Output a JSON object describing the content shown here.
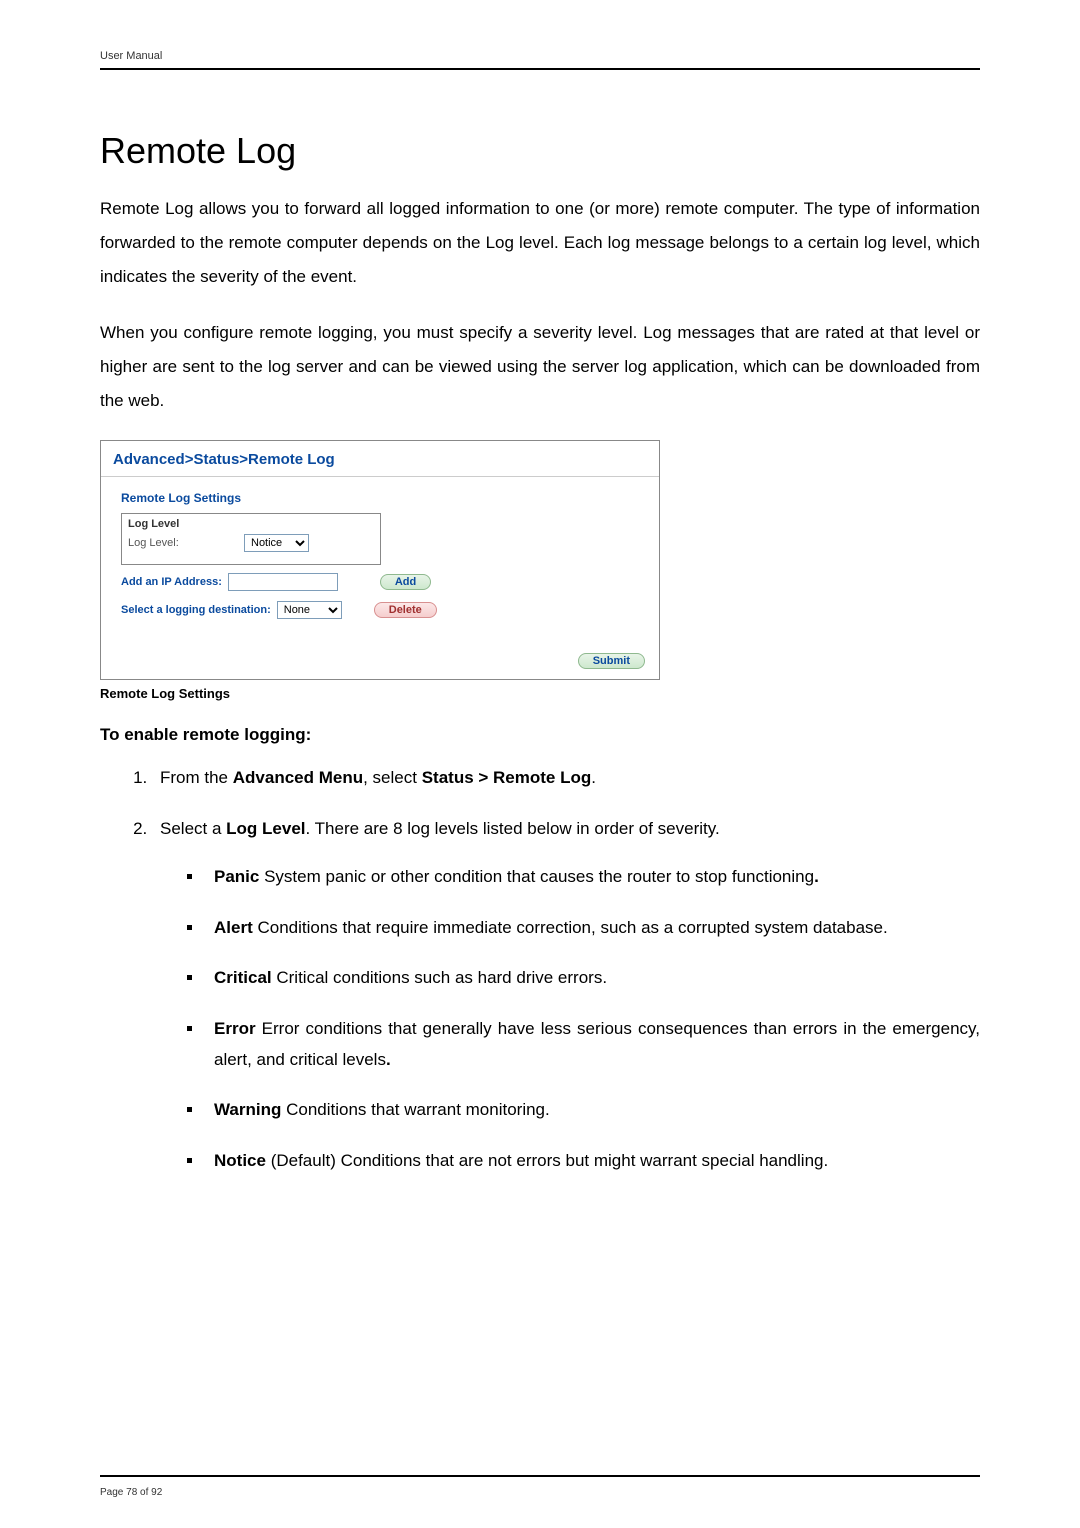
{
  "header": {
    "title": "User Manual"
  },
  "h1": "Remote Log",
  "para1": "Remote Log allows you to forward all logged information to one (or more) remote computer. The type of information forwarded to the remote computer depends on the Log level. Each log message belongs to a certain log level, which indicates the severity of the event.",
  "para2": "When you configure remote logging, you must specify a severity level. Log messages that are rated at that level or higher are sent to the log server and can be viewed using the server log application, which can be downloaded from the web.",
  "screenshot": {
    "breadcrumb": "Advanced>Status>Remote Log",
    "section_title": "Remote Log Settings",
    "loglevel_box_label": "Log Level",
    "loglevel_label": "Log Level:",
    "loglevel_value": "Notice",
    "add_ip_label": "Add an IP Address:",
    "add_btn": "Add",
    "dest_label": "Select a logging destination:",
    "dest_value": "None",
    "delete_btn": "Delete",
    "submit_btn": "Submit"
  },
  "caption": "Remote Log Settings",
  "h3": "To enable remote logging:",
  "step1_pre": "From the ",
  "step1_b1": "Advanced Menu",
  "step1_mid": ", select ",
  "step1_b2": "Status > Remote Log",
  "step1_post": ".",
  "step2_pre": "Select a ",
  "step2_b": "Log Level",
  "step2_post": ". There are 8 log levels listed below in order of severity.",
  "levels": {
    "panic_b": "Panic",
    "panic_t": " System panic or other condition that causes the router to stop functioning",
    "panic_dot": ".",
    "alert_b": "Alert",
    "alert_t": " Conditions that require immediate correction, such as a corrupted system database.",
    "critical_b": "Critical",
    "critical_t": " Critical conditions such as hard drive errors.",
    "error_b": "Error",
    "error_t": " Error conditions that generally have less serious consequences than errors in the emergency, alert, and critical levels",
    "error_dot": ".",
    "warning_b": "Warning",
    "warning_t": " Conditions that warrant monitoring.",
    "notice_b": "Notice",
    "notice_t": " (Default) Conditions that are not errors but might warrant special handling."
  },
  "footer": {
    "page": "Page 78 of 92"
  }
}
